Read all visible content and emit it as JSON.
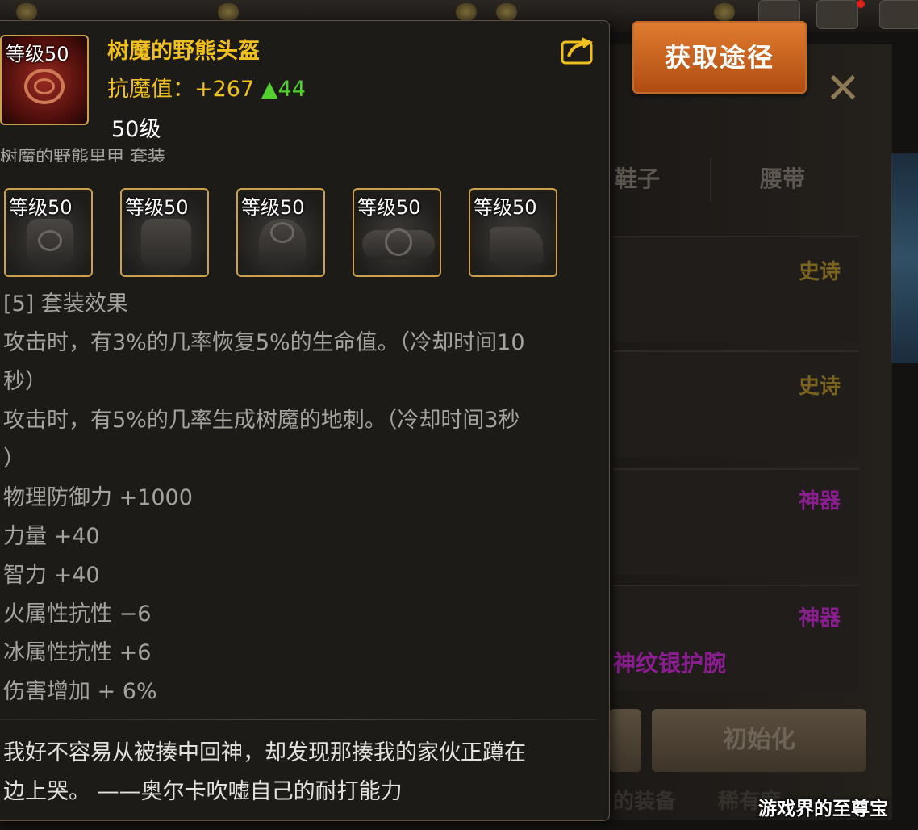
{
  "item": {
    "name": "树魔的野熊头盔",
    "level_badge": "等级50",
    "stat_label": "抗魔值：+267",
    "stat_up": "▲44",
    "required_level": "50级",
    "set_name": "树魔的野熊里甲 套装"
  },
  "set_pieces": [
    {
      "level": "等级50",
      "icon": "chest-armor-icon"
    },
    {
      "level": "等级50",
      "icon": "leg-armor-icon"
    },
    {
      "level": "等级50",
      "icon": "shoulder-armor-icon"
    },
    {
      "level": "等级50",
      "icon": "belt-icon"
    },
    {
      "level": "等级50",
      "icon": "boots-icon"
    }
  ],
  "set_effect": {
    "header": "[5] 套装效果",
    "lines": [
      "攻击时，有3%的几率恢复5%的生命值。（冷却时间10",
      "秒）",
      "攻击时，有5%的几率生成树魔的地刺。（冷却时间3秒",
      "）",
      "物理防御力 +1000",
      "力量 +40",
      "智力 +40",
      "火属性抗性 −6",
      "冰属性抗性 +6",
      "伤害增加 + 6%"
    ]
  },
  "flavor_text": [
    "我好不容易从被揍中回神，却发现那揍我的家伙正蹲在",
    "边上哭。 ——奥尔卡吹嘘自己的耐打能力"
  ],
  "get_source_button": "获取途径",
  "background": {
    "tabs": [
      "鞋子",
      "腰带"
    ],
    "rarities": [
      "史诗",
      "史诗",
      "神器",
      "神器"
    ],
    "magenta_item": "神纹银护腕",
    "init_button": "初始化",
    "bottom_labels": [
      "的装备",
      "稀有度"
    ]
  },
  "watermark": "游戏界的至尊宝",
  "colors": {
    "item_name": "#f0c020",
    "stat_up": "#52d030",
    "epic": "#b8901a",
    "artifact": "#a020a8",
    "button_orange": "#d06a20"
  }
}
